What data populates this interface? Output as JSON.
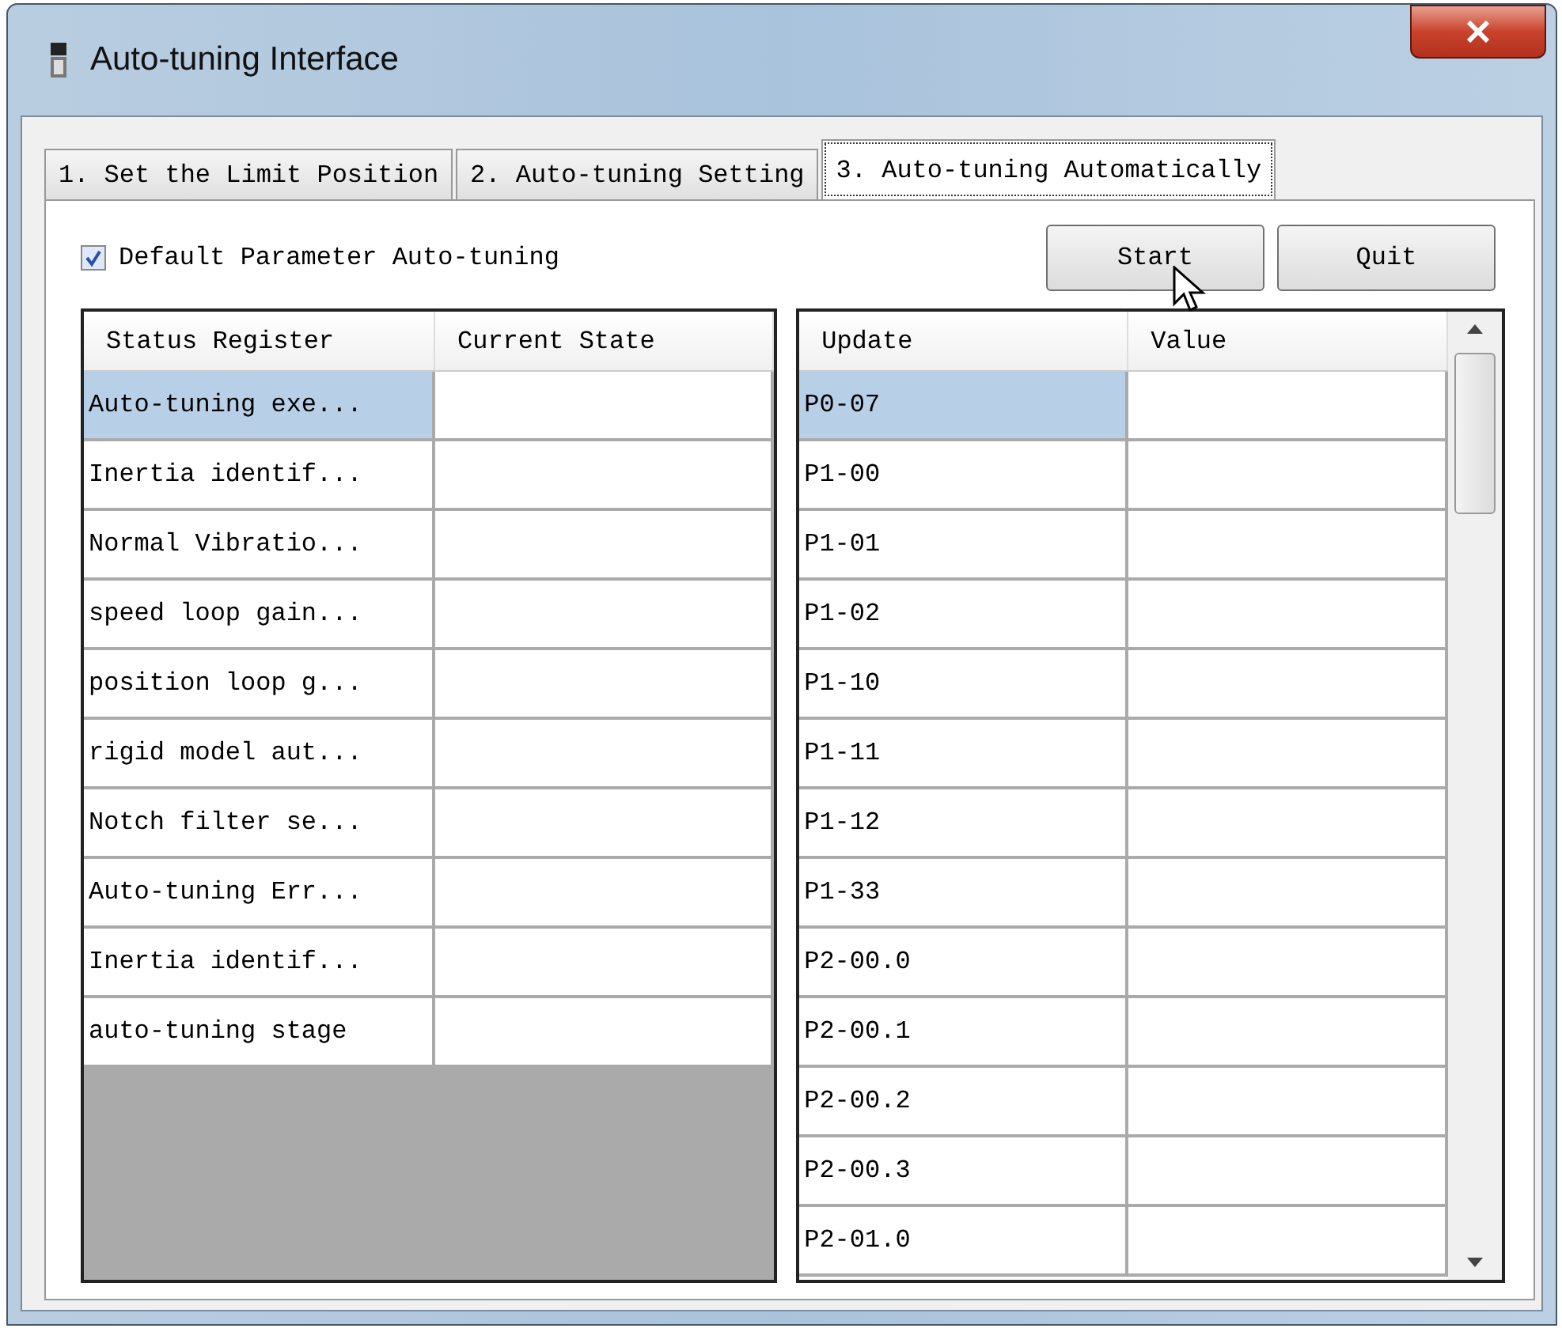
{
  "window": {
    "title": "Auto-tuning Interface"
  },
  "tabs": [
    {
      "label": "1. Set the Limit Position",
      "selected": false
    },
    {
      "label": "2. Auto-tuning Setting",
      "selected": false
    },
    {
      "label": "3. Auto-tuning Automatically",
      "selected": true
    }
  ],
  "default_parameter": {
    "label": "Default Parameter Auto-tuning",
    "checked": true
  },
  "buttons": [
    "Start",
    "Quit"
  ],
  "status_table": {
    "columns": [
      "Status Register",
      "Current State"
    ],
    "rows": [
      {
        "cells": [
          "Auto-tuning exe...",
          ""
        ],
        "selected": true
      },
      {
        "cells": [
          "Inertia identif...",
          ""
        ],
        "selected": false
      },
      {
        "cells": [
          "Normal Vibratio...",
          ""
        ],
        "selected": false
      },
      {
        "cells": [
          "speed loop gain...",
          ""
        ],
        "selected": false
      },
      {
        "cells": [
          "position loop g...",
          ""
        ],
        "selected": false
      },
      {
        "cells": [
          "rigid model aut...",
          ""
        ],
        "selected": false
      },
      {
        "cells": [
          "Notch filter se...",
          ""
        ],
        "selected": false
      },
      {
        "cells": [
          "Auto-tuning Err...",
          ""
        ],
        "selected": false
      },
      {
        "cells": [
          "Inertia identif...",
          ""
        ],
        "selected": false
      },
      {
        "cells": [
          "auto-tuning stage",
          ""
        ],
        "selected": false
      }
    ]
  },
  "update_table": {
    "columns": [
      "Update",
      "Value"
    ],
    "rows": [
      {
        "cells": [
          "P0-07",
          ""
        ],
        "selected": true
      },
      {
        "cells": [
          "P1-00",
          ""
        ],
        "selected": false
      },
      {
        "cells": [
          "P1-01",
          ""
        ],
        "selected": false
      },
      {
        "cells": [
          "P1-02",
          ""
        ],
        "selected": false
      },
      {
        "cells": [
          "P1-10",
          ""
        ],
        "selected": false
      },
      {
        "cells": [
          "P1-11",
          ""
        ],
        "selected": false
      },
      {
        "cells": [
          "P1-12",
          ""
        ],
        "selected": false
      },
      {
        "cells": [
          "P1-33",
          ""
        ],
        "selected": false
      },
      {
        "cells": [
          "P2-00.0",
          ""
        ],
        "selected": false
      },
      {
        "cells": [
          "P2-00.1",
          ""
        ],
        "selected": false
      },
      {
        "cells": [
          "P2-00.2",
          ""
        ],
        "selected": false
      },
      {
        "cells": [
          "P2-00.3",
          ""
        ],
        "selected": false
      },
      {
        "cells": [
          "P2-01.0",
          ""
        ],
        "selected": false
      }
    ]
  }
}
